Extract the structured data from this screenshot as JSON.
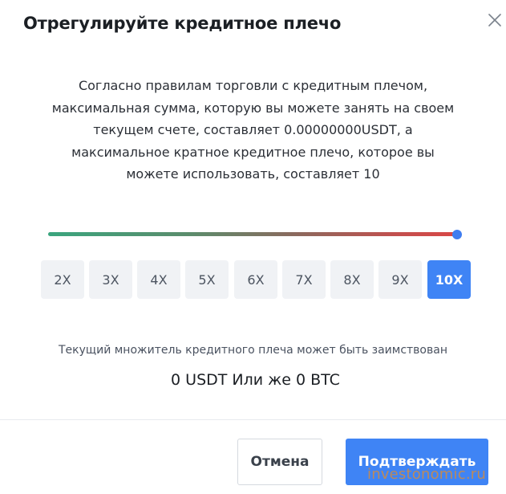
{
  "dialog": {
    "title": "Отрегулируйте кредитное плечо",
    "close_icon": "close-icon",
    "description": "Согласно правилам торговли с кредитным плечом, максимальная сумма, которую вы можете занять на своем текущем счете, составляет 0.00000000USDT, а максимальное кратное кредитное плечо, которое вы можете использовать, составляет 10",
    "slider": {
      "value": 10,
      "min": 2,
      "max": 10,
      "gradient_start": "#3aa57e",
      "gradient_end": "#d94746",
      "thumb_color": "#3f7df0"
    },
    "leverage_options": [
      {
        "label": "2X",
        "active": false
      },
      {
        "label": "3X",
        "active": false
      },
      {
        "label": "4X",
        "active": false
      },
      {
        "label": "5X",
        "active": false
      },
      {
        "label": "6X",
        "active": false
      },
      {
        "label": "7X",
        "active": false
      },
      {
        "label": "8X",
        "active": false
      },
      {
        "label": "9X",
        "active": false
      },
      {
        "label": "10X",
        "active": true
      }
    ],
    "borrow_note": "Текущий множитель кредитного плеча может быть заимствован",
    "borrow_amount": "0 USDT Или же 0 BTC",
    "cancel_label": "Отмена",
    "confirm_label": "Подтверждать",
    "accent_color": "#3f84f5"
  },
  "watermark": "investonomic.ru"
}
